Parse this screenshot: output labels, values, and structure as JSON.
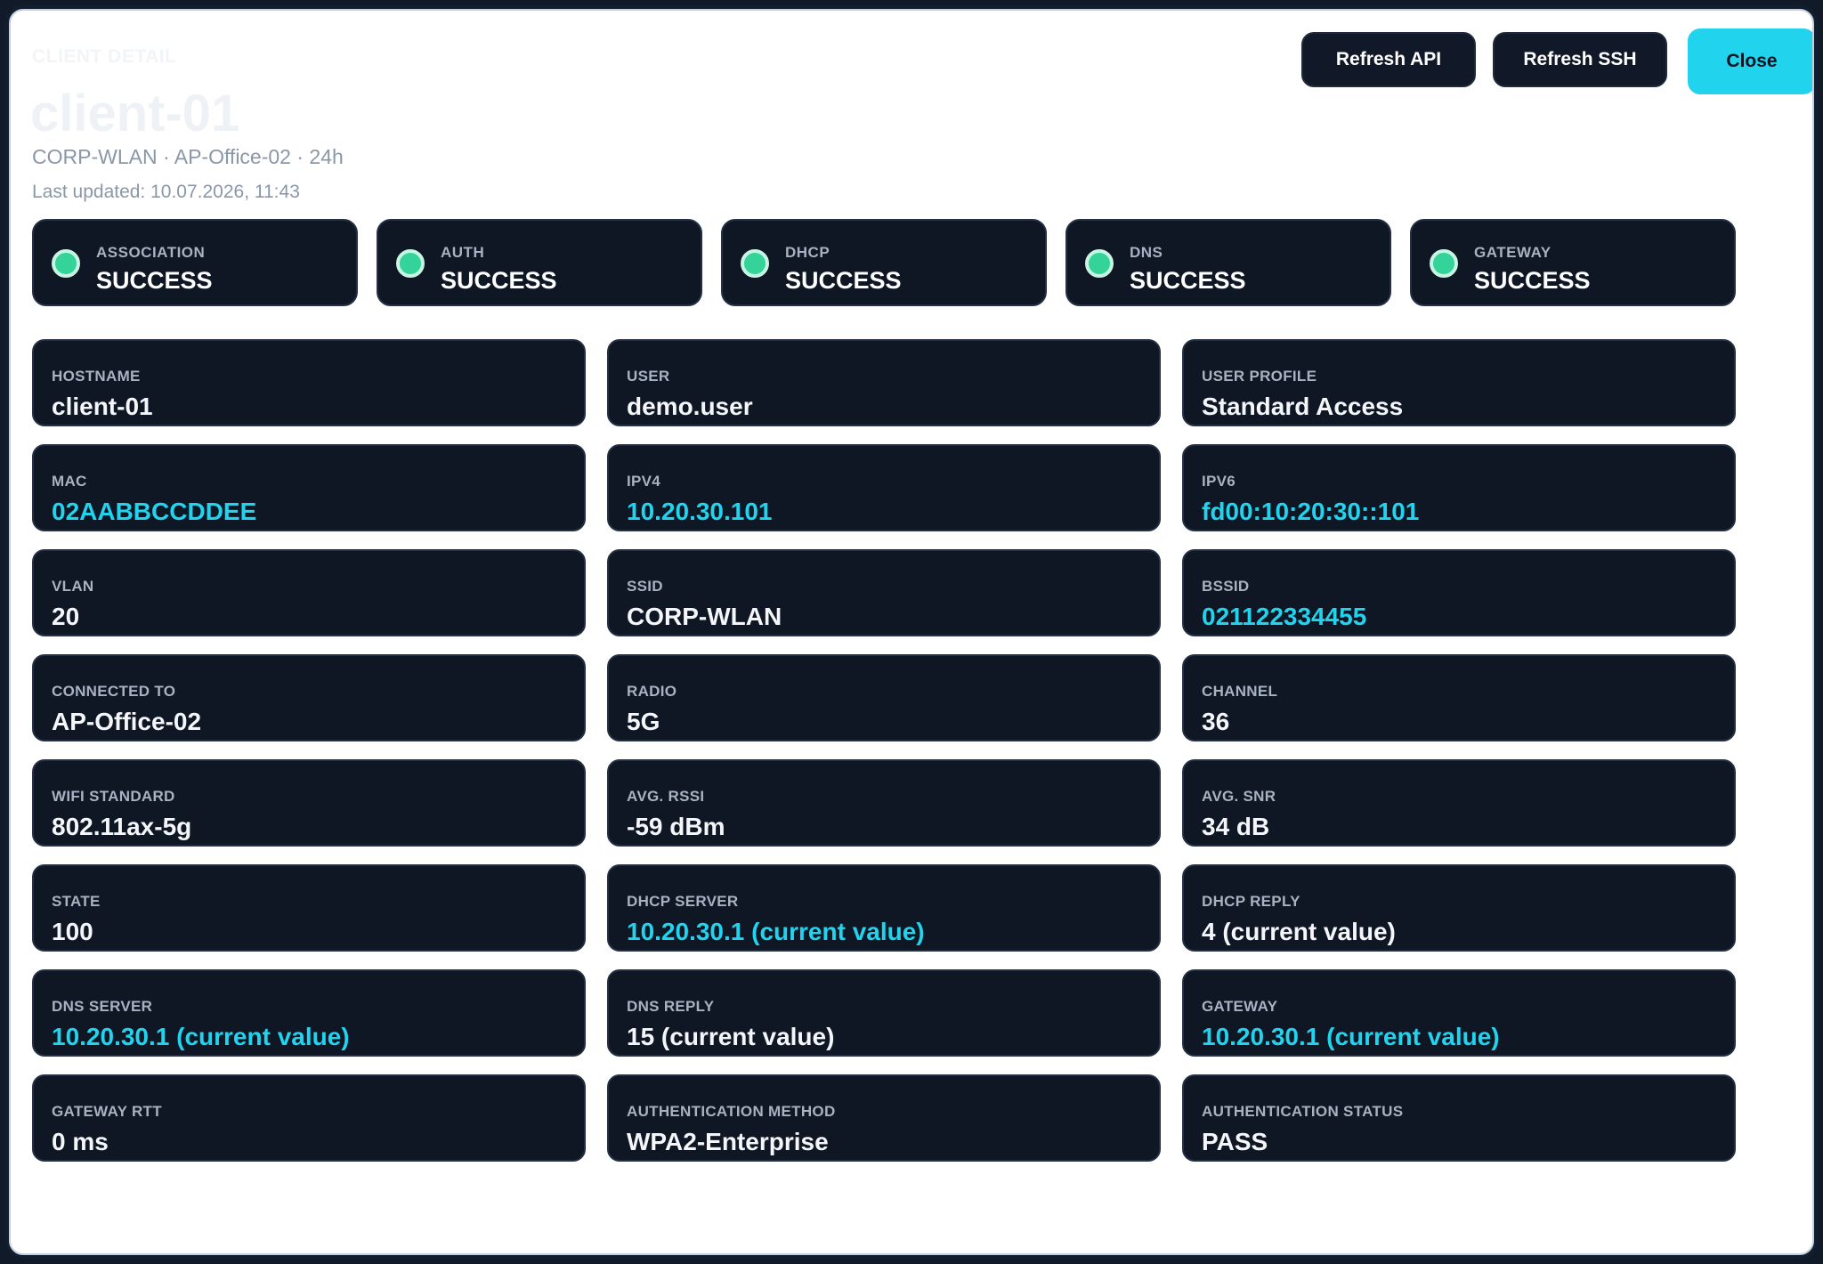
{
  "header": {
    "eyebrow": "CLIENT DETAIL",
    "title": "client-01",
    "subtitle": "CORP-WLAN · AP-Office-02 · 24h",
    "updated": "Last updated: 10.07.2026, 11:43"
  },
  "actions": {
    "refresh_api": "Refresh API",
    "refresh_ssh": "Refresh SSH",
    "close": "Close"
  },
  "colors": {
    "accent": "#22d3ee",
    "success": "#34d399",
    "card_bg": "#0f1624",
    "modal_bg": "#ffffff"
  },
  "status": [
    {
      "label": "ASSOCIATION",
      "value": "SUCCESS"
    },
    {
      "label": "AUTH",
      "value": "SUCCESS"
    },
    {
      "label": "DHCP",
      "value": "SUCCESS"
    },
    {
      "label": "DNS",
      "value": "SUCCESS"
    },
    {
      "label": "GATEWAY",
      "value": "SUCCESS"
    }
  ],
  "fields": [
    {
      "label": "HOSTNAME",
      "value": "client-01",
      "accent": false
    },
    {
      "label": "USER",
      "value": "demo.user",
      "accent": false
    },
    {
      "label": "USER PROFILE",
      "value": "Standard Access",
      "accent": false
    },
    {
      "label": "MAC",
      "value": "02AABBCCDDEE",
      "accent": true
    },
    {
      "label": "IPV4",
      "value": "10.20.30.101",
      "accent": true
    },
    {
      "label": "IPV6",
      "value": "fd00:10:20:30::101",
      "accent": true
    },
    {
      "label": "VLAN",
      "value": "20",
      "accent": false
    },
    {
      "label": "SSID",
      "value": "CORP-WLAN",
      "accent": false
    },
    {
      "label": "BSSID",
      "value": "021122334455",
      "accent": true
    },
    {
      "label": "CONNECTED TO",
      "value": "AP-Office-02",
      "accent": false
    },
    {
      "label": "RADIO",
      "value": "5G",
      "accent": false
    },
    {
      "label": "CHANNEL",
      "value": "36",
      "accent": false
    },
    {
      "label": "WIFI STANDARD",
      "value": "802.11ax-5g",
      "accent": false
    },
    {
      "label": "AVG. RSSI",
      "value": "-59 dBm",
      "accent": false
    },
    {
      "label": "AVG. SNR",
      "value": "34 dB",
      "accent": false
    },
    {
      "label": "STATE",
      "value": "100",
      "accent": false
    },
    {
      "label": "DHCP SERVER",
      "value": "10.20.30.1 (current value)",
      "accent": true
    },
    {
      "label": "DHCP REPLY",
      "value": "4 (current value)",
      "accent": false
    },
    {
      "label": "DNS SERVER",
      "value": "10.20.30.1 (current value)",
      "accent": true
    },
    {
      "label": "DNS REPLY",
      "value": "15 (current value)",
      "accent": false
    },
    {
      "label": "GATEWAY",
      "value": "10.20.30.1 (current value)",
      "accent": true
    },
    {
      "label": "GATEWAY RTT",
      "value": "0 ms",
      "accent": false
    },
    {
      "label": "AUTHENTICATION METHOD",
      "value": "WPA2-Enterprise",
      "accent": false
    },
    {
      "label": "AUTHENTICATION STATUS",
      "value": "PASS",
      "accent": false
    }
  ]
}
